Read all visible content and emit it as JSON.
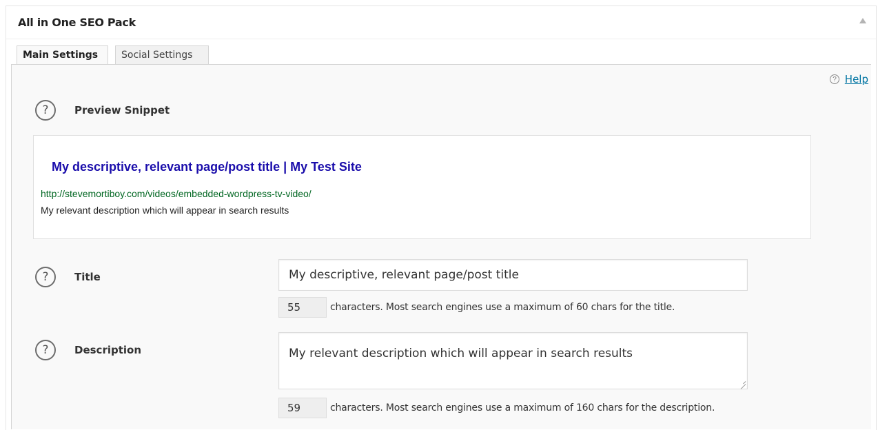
{
  "metabox": {
    "title": "All in One SEO Pack"
  },
  "tabs": [
    {
      "label": "Main Settings",
      "active": true
    },
    {
      "label": "Social Settings",
      "active": false
    }
  ],
  "help": {
    "icon_glyph": "?",
    "label": "Help"
  },
  "preview": {
    "label": "Preview Snippet",
    "title": "My descriptive, relevant page/post title | My Test Site",
    "url": "http://stevemortiboy.com/videos/embedded-wordpress-tv-video/",
    "description": "My relevant description which will appear in search results"
  },
  "fields": {
    "title": {
      "label": "Title",
      "value": "My descriptive, relevant page/post title",
      "count": "55",
      "count_text": "characters. Most search engines use a maximum of 60 chars for the title."
    },
    "description": {
      "label": "Description",
      "value": "My relevant description which will appear in search results",
      "count": "59",
      "count_text": "characters. Most search engines use a maximum of 160 chars for the description."
    }
  },
  "help_icon_glyph": "?",
  "colors": {
    "link": "#0074a2",
    "snippet_title": "#1a0dab",
    "snippet_url": "#006621"
  }
}
